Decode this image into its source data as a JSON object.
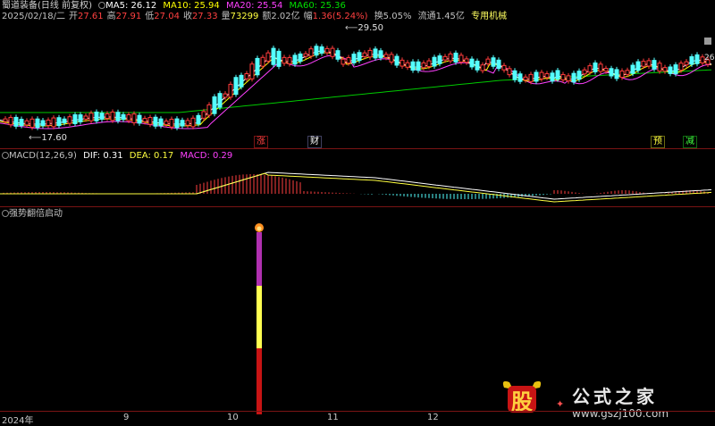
{
  "stock": {
    "name": "蜀道装备",
    "mode": "(日线 前复权)",
    "date": "2025/02/18/二",
    "open_label": "开",
    "open": "27.61",
    "high_label": "高",
    "high": "27.91",
    "low_label": "低",
    "low": "27.04",
    "close_label": "收",
    "close": "27.33",
    "vol_label": "量",
    "vol": "73299",
    "amt_label": "额",
    "amt": "2.02亿",
    "chg_label": "幅",
    "chg": "1.36(5.24%)",
    "turnover": "换5.05%",
    "float": "流通1.45亿",
    "industry": "专用机械"
  },
  "ma": {
    "ma5": "MA5: 26.12",
    "ma10": "MA10: 25.94",
    "ma20": "MA20: 25.54",
    "ma60": "MA60: 25.36"
  },
  "price_marks": {
    "high_mark": "29.50",
    "low_mark": "17.60",
    "right_mark": "26"
  },
  "event_tags": {
    "zhang": "涨",
    "cai": "财",
    "yu": "预",
    "jian": "减"
  },
  "macd": {
    "title": "MACD(12,26,9)",
    "dif": "DIF: 0.31",
    "dea": "DEA: 0.17",
    "macd": "MACD: 0.29"
  },
  "indicator": {
    "title": "强势翻倍启动"
  },
  "xaxis": {
    "y2024": "2024年",
    "m9": "9",
    "m10": "10",
    "m11": "11",
    "m12": "12"
  },
  "watermark": {
    "logo_char": "股",
    "text": "公式之家",
    "url": "www.gszj100.com"
  },
  "colors": {
    "up": "#ff3c3c",
    "down": "#54ffff",
    "ma5": "#ffffff",
    "ma10": "#ffff00",
    "ma20": "#ff40ff",
    "ma60": "#00c800",
    "red": "#ff4040",
    "yellow": "#ffff40",
    "magenta": "#ff40ff"
  }
}
